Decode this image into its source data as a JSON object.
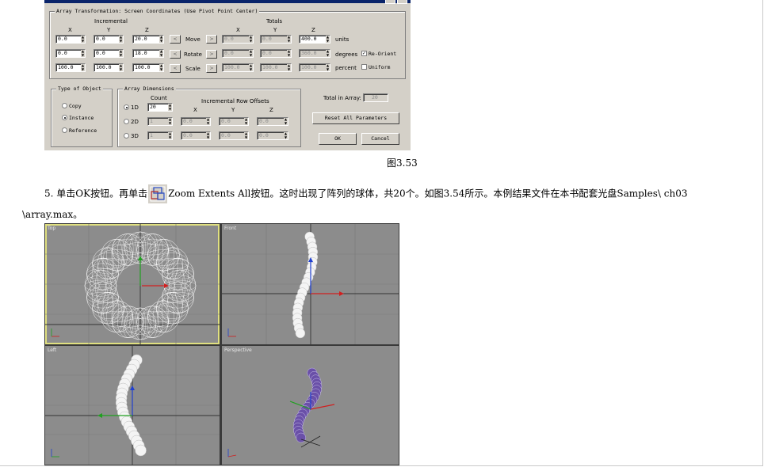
{
  "dialog": {
    "transform_group_title": "Array Transformation: Screen Coordinates (Use Pivot Point Center)",
    "incremental_label": "Incremental",
    "totals_label": "Totals",
    "axis_labels": [
      "X",
      "Y",
      "Z"
    ],
    "rows": [
      {
        "name": "Move",
        "inc": [
          "0.0",
          "0.0",
          "20.0"
        ],
        "tot": [
          "0.0",
          "0.0",
          "400.0"
        ],
        "unit": "units"
      },
      {
        "name": "Rotate",
        "inc": [
          "0.0",
          "0.0",
          "18.0"
        ],
        "tot": [
          "0.0",
          "0.0",
          "360.0"
        ],
        "unit": "degrees"
      },
      {
        "name": "Scale",
        "inc": [
          "100.0",
          "100.0",
          "100.0"
        ],
        "tot": [
          "100.0",
          "100.0",
          "100.0"
        ],
        "unit": "percent"
      }
    ],
    "reorient_label": "Re-Orient",
    "uniform_label": "Uniform",
    "type_group_title": "Type of Object",
    "type_options": [
      "Copy",
      "Instance",
      "Reference"
    ],
    "type_selected": "Instance",
    "dims_group_title": "Array Dimensions",
    "count_label": "Count",
    "row_offsets_label": "Incremental Row Offsets",
    "dims": [
      {
        "name": "1D",
        "count": "20"
      },
      {
        "name": "2D",
        "count": "1",
        "offsets": [
          "0.0",
          "0.0",
          "0.0"
        ]
      },
      {
        "name": "3D",
        "count": "1",
        "offsets": [
          "0.0",
          "0.0",
          "0.0"
        ]
      }
    ],
    "total_label": "Total in Array:",
    "total_value": "20",
    "reset_label": "Reset All Parameters",
    "ok_label": "OK",
    "cancel_label": "Cancel"
  },
  "caption_1": "图3.53",
  "paragraph": {
    "line1_before": "5. 单击OK按钮。再单击",
    "line1_after": "Zoom Extents All按钮。这时出现了阵列的球体，共20个。如图3.54所示。本例结果文件在本书配套光盘Samples\\ ch03",
    "line2": "\\array.max。"
  },
  "viewports": {
    "top": "Top",
    "front": "Front",
    "left": "Left",
    "perspective": "Perspective"
  }
}
